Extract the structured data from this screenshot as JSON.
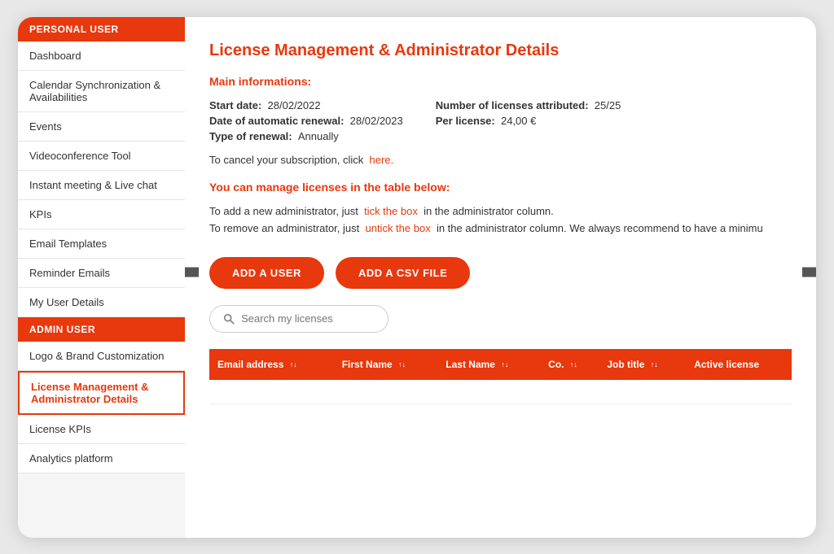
{
  "sidebar": {
    "personal_user_header": "PERSONAL USER",
    "admin_user_header": "ADMIN USER",
    "personal_items": [
      {
        "label": "Dashboard",
        "active": false
      },
      {
        "label": "Calendar Synchronization & Availabilities",
        "active": false
      },
      {
        "label": "Events",
        "active": false
      },
      {
        "label": "Videoconference Tool",
        "active": false
      },
      {
        "label": "Instant meeting & Live chat",
        "active": false
      },
      {
        "label": "KPIs",
        "active": false
      },
      {
        "label": "Email Templates",
        "active": false
      },
      {
        "label": "Reminder Emails",
        "active": false
      },
      {
        "label": "My User Details",
        "active": false
      }
    ],
    "admin_items": [
      {
        "label": "Logo & Brand Customization",
        "active": false
      },
      {
        "label": "License Management & Administrator Details",
        "active": true
      },
      {
        "label": "License KPIs",
        "active": false
      },
      {
        "label": "Analytics platform",
        "active": false
      }
    ]
  },
  "main": {
    "title": "License Management & Administrator Details",
    "section1": {
      "subtitle": "Main informations:",
      "start_date_label": "Start date:",
      "start_date_value": "28/02/2022",
      "renewal_date_label": "Date of automatic renewal:",
      "renewal_date_value": "28/02/2023",
      "renewal_type_label": "Type of renewal:",
      "renewal_type_value": "Annually",
      "licenses_label": "Number of licenses attributed:",
      "licenses_value": "25/25",
      "per_license_label": "Per license:",
      "per_license_value": "24,00 €",
      "cancel_text": "To cancel your subscription, click",
      "cancel_link": "here."
    },
    "section2": {
      "subtitle": "You can manage licenses in the table below:",
      "add_instruction": "To add a new administrator, just",
      "add_link": "tick the box",
      "add_instruction2": "in the administrator column.",
      "remove_instruction": "To remove an administrator, just",
      "remove_link": "untick the box",
      "remove_instruction2": "in the administrator column. We always recommend to have a minimu"
    },
    "buttons": {
      "add_user": "ADD A USER",
      "add_csv": "ADD A CSV FILE"
    },
    "search": {
      "placeholder": "Search my licenses"
    },
    "table": {
      "columns": [
        {
          "label": "Email address",
          "sortable": true
        },
        {
          "label": "First Name",
          "sortable": true
        },
        {
          "label": "Last Name",
          "sortable": true
        },
        {
          "label": "Co.",
          "sortable": true
        },
        {
          "label": "Job title",
          "sortable": true
        },
        {
          "label": "Active license",
          "sortable": false
        }
      ]
    }
  }
}
